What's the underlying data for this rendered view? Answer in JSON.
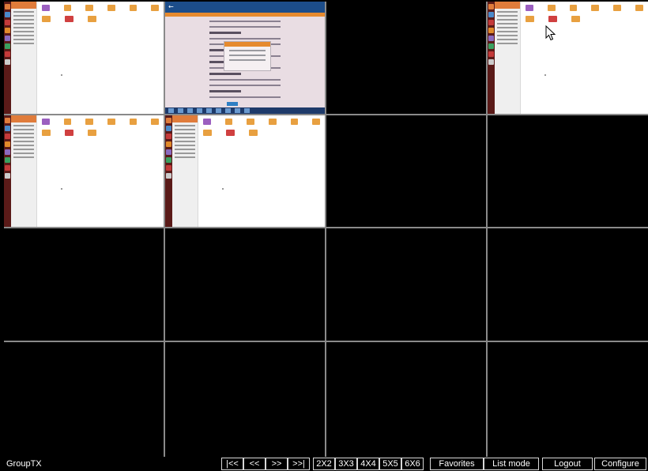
{
  "toolbar": {
    "group_name": "GroupTX",
    "first_label": "|<<",
    "prev_label": "<<",
    "next_label": ">>",
    "last_label": ">>|",
    "layouts": [
      "2X2",
      "3X3",
      "4X4",
      "5X5",
      "6X6"
    ],
    "favorites_label": "Favorites",
    "list_mode_label": "List mode",
    "logout_label": "Logout",
    "configure_label": "Configure"
  },
  "grid": {
    "layout": "4X4",
    "cells": [
      {
        "content": "file-manager"
      },
      {
        "content": "web-settings"
      },
      {
        "content": "black"
      },
      {
        "content": "file-manager"
      },
      {
        "content": "file-manager"
      },
      {
        "content": "file-manager"
      },
      {
        "content": "black"
      },
      {
        "content": "black"
      },
      {
        "content": "black"
      },
      {
        "content": "black"
      },
      {
        "content": "black"
      },
      {
        "content": "black"
      },
      {
        "content": "black"
      },
      {
        "content": "black"
      },
      {
        "content": "black"
      },
      {
        "content": "black"
      }
    ]
  },
  "colors": {
    "background": "#000000",
    "grid_lines": "#8a8a8a",
    "toolbar_text": "#ffffff",
    "launcher": "#5a1a18",
    "accent_orange": "#e07c3b"
  }
}
